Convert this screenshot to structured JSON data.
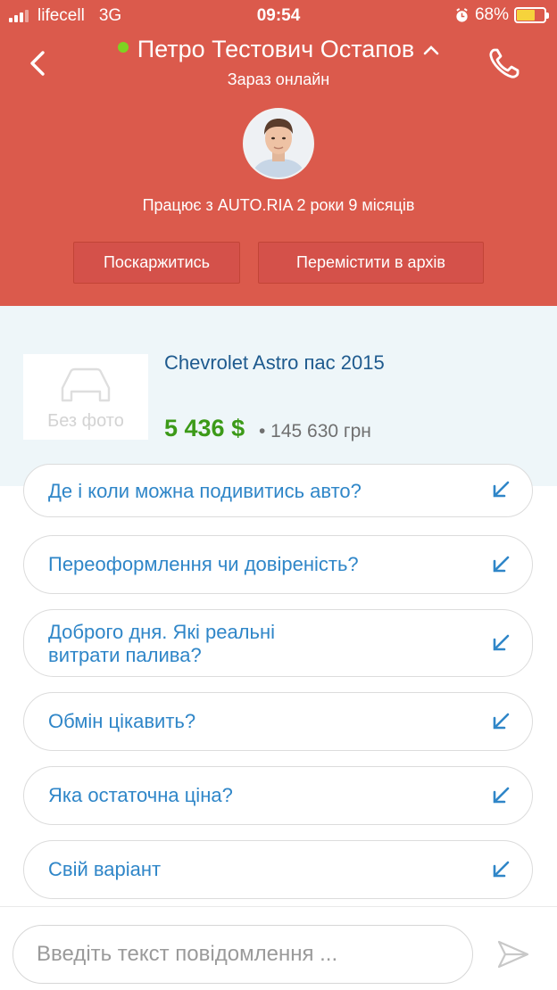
{
  "status_bar": {
    "carrier": "lifecell",
    "network": "3G",
    "time": "09:54",
    "battery": "68%",
    "battery_level": 0.68
  },
  "header": {
    "name": "Петро Тестович Остапов",
    "status": "Зараз онлайн",
    "tenure": "Працює з AUTO.RIA 2 роки 9 місяців",
    "complain_button": "Поскаржитись",
    "archive_button": "Перемістити в архів",
    "online_color": "#7ed321",
    "background_color": "#db5a4c"
  },
  "listing": {
    "title": "Chevrolet Astro пас 2015",
    "no_photo": "Без фото",
    "price_usd": "5 436 $",
    "price_uah": "• 145 630 грн"
  },
  "quick_replies": [
    {
      "text": "Де і коли можна подивитись авто?"
    },
    {
      "text": "Переоформлення чи довіреність?"
    },
    {
      "text": "Доброго дня. Які реальні витрати палива?"
    },
    {
      "text": "Обмін цікавить?"
    },
    {
      "text": "Яка остаточна ціна?"
    },
    {
      "text": "Свій варіант"
    }
  ],
  "composer": {
    "placeholder": "Введіть текст повідомлення ..."
  }
}
